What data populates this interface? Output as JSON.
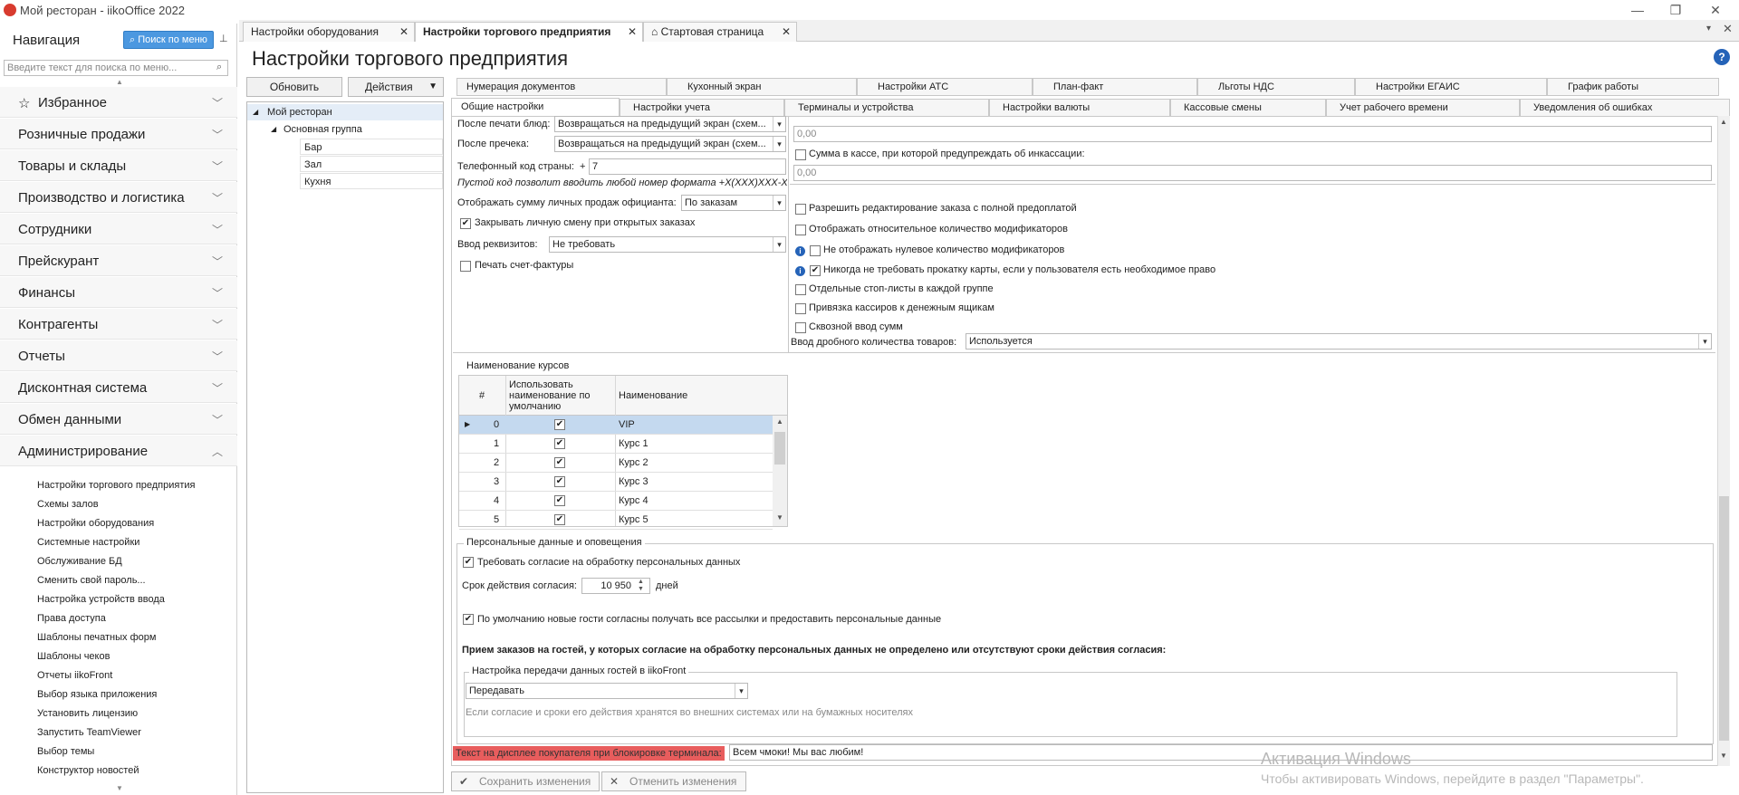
{
  "window": {
    "title": "Мой ресторан - iikoOffice 2022"
  },
  "nav": {
    "title": "Навигация",
    "search_button": "Поиск по меню",
    "search_placeholder": "Введите текст для поиска по меню...",
    "sections": [
      "Избранное",
      "Розничные продажи",
      "Товары и склады",
      "Производство и логистика",
      "Сотрудники",
      "Прейскурант",
      "Финансы",
      "Контрагенты",
      "Отчеты",
      "Дисконтная система",
      "Обмен данными",
      "Администрирование"
    ],
    "admin_items": [
      "Настройки торгового предприятия",
      "Схемы залов",
      "Настройки оборудования",
      "Системные настройки",
      "Обслуживание БД",
      "Сменить свой пароль...",
      "Настройка устройств ввода",
      "Права доступа",
      "Шаблоны печатных форм",
      "Шаблоны чеков",
      "Отчеты iikoFront",
      "Выбор языка приложения",
      "Установить лицензию",
      "Запустить TeamViewer",
      "Выбор темы",
      "Конструктор новостей"
    ]
  },
  "doc_tabs": [
    "Настройки оборудования",
    "Настройки торгового предприятия",
    "Стартовая страница"
  ],
  "page_title": "Настройки торгового предприятия",
  "toolbar": {
    "refresh": "Обновить",
    "actions": "Действия"
  },
  "tree": [
    "Мой ресторан",
    "Основная группа",
    "Бар",
    "Зал",
    "Кухня"
  ],
  "settings_tabs_row1": [
    "Нумерация документов",
    "Кухонный экран",
    "Настройки АТС",
    "План-факт",
    "Льготы НДС",
    "Настройки ЕГАИС",
    "График работы"
  ],
  "settings_tabs_row2": [
    "Общие настройки",
    "Настройки учета",
    "Терминалы и устройства",
    "Настройки валюты",
    "Кассовые смены",
    "Учет рабочего времени",
    "Уведомления об ошибках"
  ],
  "left_form": {
    "after_dish_print_label": "После печати блюд:",
    "after_dish_print_value": "Возвращаться на предыдущий экран (схем...",
    "after_precheck_label": "После пречека:",
    "after_precheck_value": "Возвращаться на предыдущий экран (схем...",
    "phone_code_label": "Телефонный код страны:",
    "phone_plus": "+",
    "phone_code_value": "7",
    "phone_hint": "Пустой код позволит вводить любой номер формата +X(XXX)XXX-XX-XX",
    "waiter_sales_label": "Отображать сумму личных продаж официанта:",
    "waiter_sales_value": "По заказам",
    "close_shift_label": "Закрывать личную смену при открытых заказах",
    "requisites_label": "Ввод реквизитов:",
    "requisites_value": "Не требовать",
    "invoice_label": "Печать счет-фактуры"
  },
  "right_form": {
    "amount1_value": "0,00",
    "cash_warn_label": "Сумма в кассе, при которой предупреждать об инкассации:",
    "amount2_value": "0,00",
    "checks": [
      "Разрешить редактирование заказа с полной предоплатой",
      "Отображать относительное количество модификаторов",
      "Не отображать нулевое количество модификаторов",
      "Никогда не требовать прокатку карты, если у пользователя есть необходимое право",
      "Отдельные стоп-листы в каждой группе",
      "Привязка кассиров к денежным ящикам",
      "Сквозной ввод сумм"
    ],
    "fractional_label": "Ввод дробного количества товаров:",
    "fractional_value": "Используется"
  },
  "courses": {
    "title": "Наименование курсов",
    "col_num": "#",
    "col_default": "Использовать наименование по умолчанию",
    "col_name": "Наименование",
    "rows": [
      {
        "num": "0",
        "name": "VIP"
      },
      {
        "num": "1",
        "name": "Курс 1"
      },
      {
        "num": "2",
        "name": "Курс 2"
      },
      {
        "num": "3",
        "name": "Курс 3"
      },
      {
        "num": "4",
        "name": "Курс 4"
      },
      {
        "num": "5",
        "name": "Курс 5"
      }
    ]
  },
  "personal": {
    "title": "Персональные данные и оповещения",
    "require_consent": "Требовать согласие на обработку персональных данных",
    "consent_term_label": "Срок действия согласия:",
    "consent_term_value": "10 950",
    "consent_term_unit": "дней",
    "default_consent": "По умолчанию новые гости согласны получать все рассылки и предоставить персональные данные",
    "bold_note": "Прием заказов на гостей, у которых согласие на обработку персональных данных не определено или отсутствуют сроки действия согласия:",
    "transfer_group": "Настройка передачи данных гостей в iikoFront",
    "transfer_value": "Передавать",
    "transfer_hint": "Если согласие и сроки его действия хранятся во внешних системах или на бумажных носителях"
  },
  "lock_text": {
    "label": "Текст на дисплее покупателя при блокировке терминала:",
    "value": "Всем чмоки! Мы вас любим!"
  },
  "bottom": {
    "save": "Сохранить изменения",
    "cancel": "Отменить изменения"
  },
  "watermark": {
    "line1": "Активация Windows",
    "line2": "Чтобы активировать Windows, перейдите в раздел \"Параметры\"."
  },
  "colors": {
    "accent": "#4c98e0",
    "highlight_red": "#e85d5d",
    "selection": "#c4d9ef"
  }
}
